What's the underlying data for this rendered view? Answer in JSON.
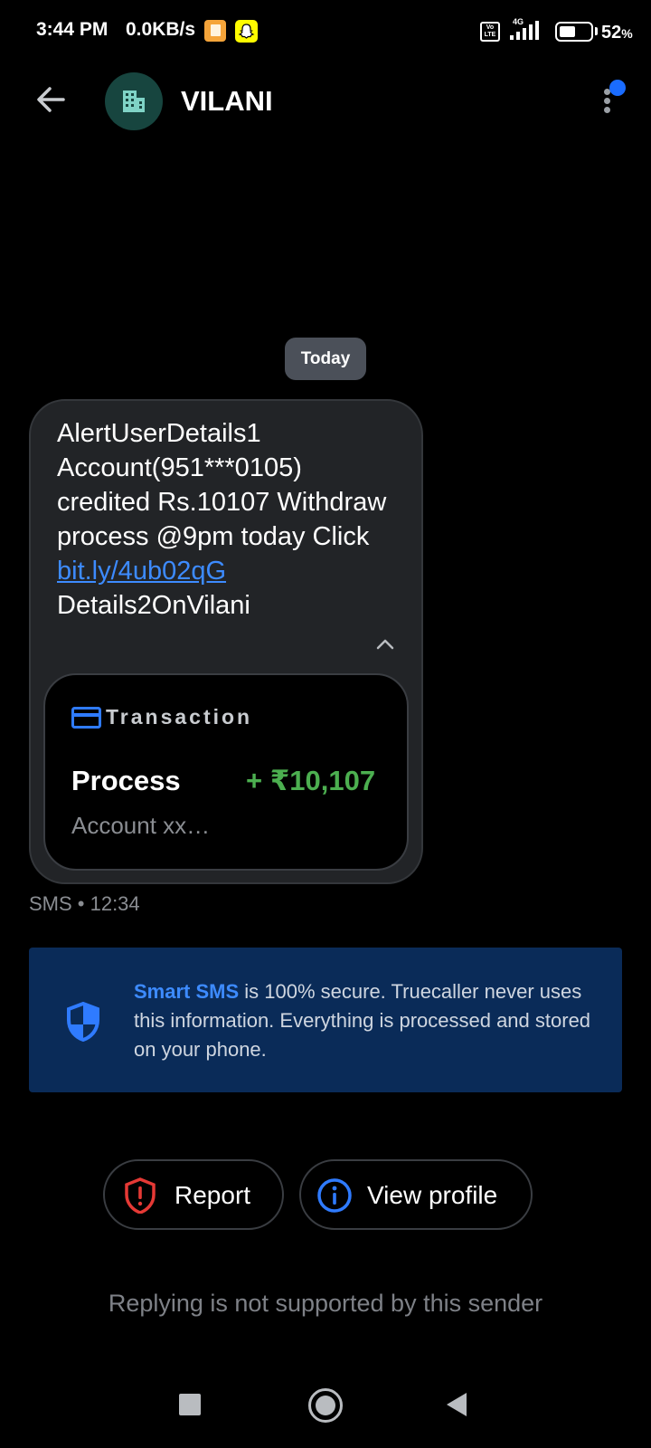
{
  "status_bar": {
    "time": "3:44 PM",
    "net_speed": "0.0KB/s",
    "volte": "Vo LTE",
    "network": "4G",
    "battery_level": 0.52,
    "battery_percent": "52",
    "battery_unit": "%"
  },
  "header": {
    "title": "VILANI",
    "avatar_icon": "building-icon",
    "back_icon": "arrow-left-icon",
    "menu_icon": "more-vert-icon",
    "badge_color": "#1a6cff"
  },
  "date_chip": "Today",
  "message": {
    "text_before_link": "AlertUserDetails1 Account(951***0105) credited Rs.10107 Withdraw process @9pm today Click ",
    "link": "bit.ly/4ub02qG",
    "text_after_link": "Details2OnVilani",
    "meta": "SMS • 12:34",
    "link_color": "#3d8bff"
  },
  "transaction_card": {
    "label": "Transaction",
    "title": "Process",
    "amount": "+ ₹10,107",
    "account": "Account xx…",
    "amount_color": "#4caf50"
  },
  "secure_banner": {
    "brand": "Smart SMS",
    "text": " is 100% secure. Truecaller never uses this information. Everything is processed and stored on your phone.",
    "background": "#0a2b58"
  },
  "actions": {
    "report_label": "Report",
    "view_profile_label": "View profile"
  },
  "reply_note": "Replying is not supported by this sender"
}
